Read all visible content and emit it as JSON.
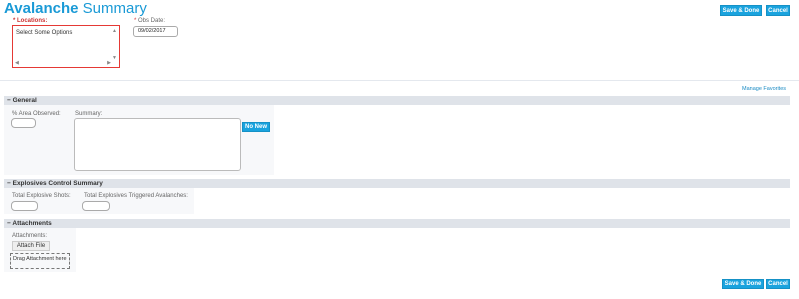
{
  "header": {
    "title_part1": "Avalanche",
    "title_part2": "Summary",
    "save_done": "Save & Done",
    "cancel": "Cancel"
  },
  "form": {
    "locations_required": "*",
    "locations_label": "Locations:",
    "locations_placeholder": "Select Some Options",
    "obs_date_required": "*",
    "obs_date_label": "Obs Date:",
    "obs_date_value": "09/02/2017",
    "scroll_up": "▲",
    "scroll_down": "▼",
    "scroll_left": "◀",
    "scroll_right": "▶"
  },
  "links": {
    "manage_favorites": "Manage Favorites"
  },
  "general": {
    "toggle": "−",
    "title": "General",
    "area_observed_label": "% Area Observed:",
    "summary_label": "Summary:",
    "no_new_button": "No New"
  },
  "explosives": {
    "toggle": "−",
    "title": "Explosives Control Summary",
    "total_shots_label": "Total Explosive Shots:",
    "total_triggered_label": "Total Explosives Triggered Avalanches:"
  },
  "attachments": {
    "toggle": "−",
    "title": "Attachments",
    "label": "Attachments:",
    "attach_button": "Attach File",
    "drop_zone": "Drag Attachment here"
  },
  "footer": {
    "save_done": "Save & Done",
    "cancel": "Cancel"
  },
  "colors": {
    "brand_blue": "#1aa3de",
    "required_red": "#e53935",
    "section_header": "#dfe3e9"
  }
}
